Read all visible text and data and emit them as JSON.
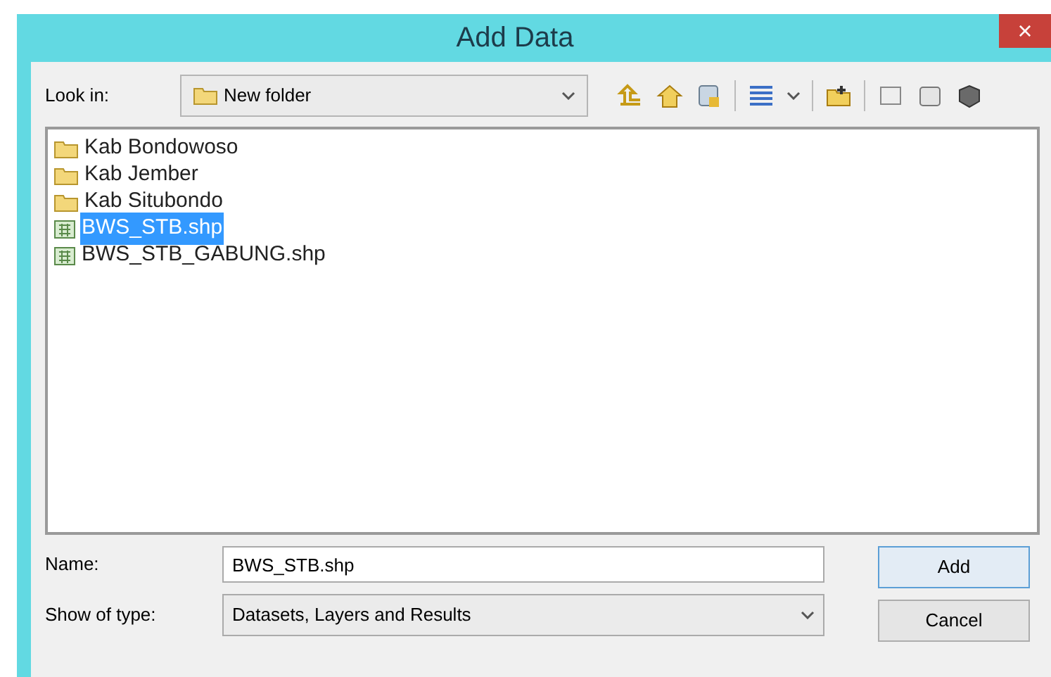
{
  "window": {
    "title": "Add Data",
    "close": "×"
  },
  "look_in": {
    "label": "Look in:",
    "value": "New folder"
  },
  "files": [
    {
      "name": "Kab Bondowoso",
      "kind": "folder",
      "selected": false
    },
    {
      "name": "Kab Jember",
      "kind": "folder",
      "selected": false
    },
    {
      "name": "Kab Situbondo",
      "kind": "folder",
      "selected": false
    },
    {
      "name": "BWS_STB.shp",
      "kind": "shapefile",
      "selected": true
    },
    {
      "name": "BWS_STB_GABUNG.shp",
      "kind": "shapefile",
      "selected": false
    }
  ],
  "name_field": {
    "label": "Name:",
    "value": "BWS_STB.shp"
  },
  "type_field": {
    "label": "Show of type:",
    "value": "Datasets, Layers and Results"
  },
  "buttons": [
    "Add",
    "Cancel"
  ]
}
